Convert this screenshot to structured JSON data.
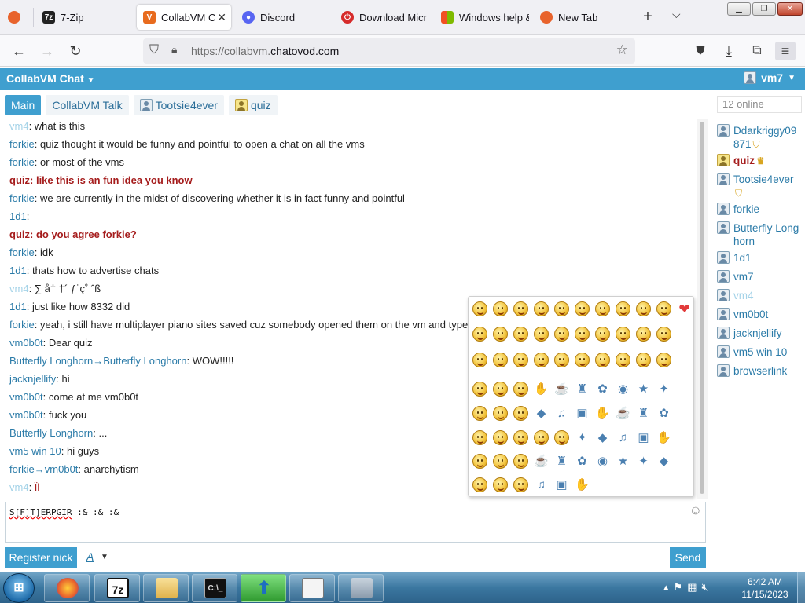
{
  "browser": {
    "tabs": [
      {
        "label": "7-Zip",
        "icon": "7zip-icon"
      },
      {
        "label": "CollabVM Ch",
        "icon": "collabvm-icon",
        "active": true
      },
      {
        "label": "Discord",
        "icon": "discord-icon"
      },
      {
        "label": "Download Micr",
        "icon": "microsoft-icon"
      },
      {
        "label": "Windows help &",
        "icon": "windows-icon"
      },
      {
        "label": "New Tab",
        "icon": "firefox-icon"
      }
    ],
    "url_prefix": "https://collabvm.",
    "url_domain": "chatovod.com"
  },
  "chat": {
    "title": "CollabVM Chat",
    "current_user": "vm7",
    "tabs": [
      "Main",
      "CollabVM Talk",
      "Tootsie4ever",
      "quiz"
    ],
    "messages": [
      {
        "nick": "vm4",
        "text": "what is this",
        "style": "faded"
      },
      {
        "nick": "forkie",
        "text": "quiz thought it would be funny and pointful to open a chat on all the vms"
      },
      {
        "nick": "forkie",
        "text": "or most of the vms"
      },
      {
        "nick": "quiz",
        "text": "like this is an fun idea you know",
        "style": "admin"
      },
      {
        "nick": "forkie",
        "text": "we are currently in the midst of discovering whether it is in fact funny and pointful"
      },
      {
        "nick": "1d1",
        "text": ""
      },
      {
        "nick": "quiz",
        "text": "do you agree forkie?",
        "style": "admin"
      },
      {
        "nick": "forkie",
        "text": "idk"
      },
      {
        "nick": "1d1",
        "text": "thats how to advertise chats"
      },
      {
        "nick": "vm4",
        "text": "∑ å† †´ ƒ˙ç˚ ˆß",
        "style": "faded"
      },
      {
        "nick": "1d1",
        "text": "just like how 8332 did"
      },
      {
        "nick": "forkie",
        "text": "yeah, i still have multiplayer piano sites saved cuz somebody opened them on the vm and typed"
      },
      {
        "nick": "vm0b0t",
        "text": "Dear quiz"
      },
      {
        "nick": "Butterfly Longhorn→Butterfly Longhorn",
        "text": "WOW!!!!!"
      },
      {
        "nick": "jacknjellify",
        "text": "hi"
      },
      {
        "nick": "vm0b0t",
        "text": "come at me vm0b0t"
      },
      {
        "nick": "vm0b0t",
        "text": "fuck you"
      },
      {
        "nick": "Butterfly Longhorn",
        "text": "..."
      },
      {
        "nick": "vm5 win 10",
        "text": "hi guys"
      },
      {
        "nick": "forkie→vm0b0t",
        "text": "anarchytism"
      },
      {
        "nick": "vm4",
        "text": "Ïl",
        "style": "faded"
      }
    ],
    "input_prefix": "S[F]T]ERPGIR",
    "input_rest": " :& :& :&",
    "register_label": "Register nick",
    "font_label": "A",
    "send_label": "Send",
    "online_label": "12 online",
    "users": [
      {
        "name": "Ddarkriggy09871",
        "badge": "shield-icon"
      },
      {
        "name": "quiz",
        "badge": "crown-icon",
        "style": "admin"
      },
      {
        "name": "Tootsie4ever",
        "badge": "shield-icon"
      },
      {
        "name": "forkie"
      },
      {
        "name": "Butterfly Longhorn"
      },
      {
        "name": "1d1"
      },
      {
        "name": "vm7"
      },
      {
        "name": "vm4",
        "style": "faded"
      },
      {
        "name": "vm0b0t"
      },
      {
        "name": "jacknjellify"
      },
      {
        "name": "vm5 win 10"
      },
      {
        "name": "browserlink"
      }
    ]
  },
  "taskbar": {
    "time": "6:42 AM",
    "date": "11/15/2023",
    "apps": [
      "firefox-icon",
      "7zip-icon",
      "explorer-icon",
      "cmd-icon",
      "update-icon",
      "notepad-icon",
      "system-icon"
    ]
  },
  "colors": {
    "accent": "#3f9fcf",
    "admin": "#a51c1c",
    "nick": "#2b7ba8"
  }
}
